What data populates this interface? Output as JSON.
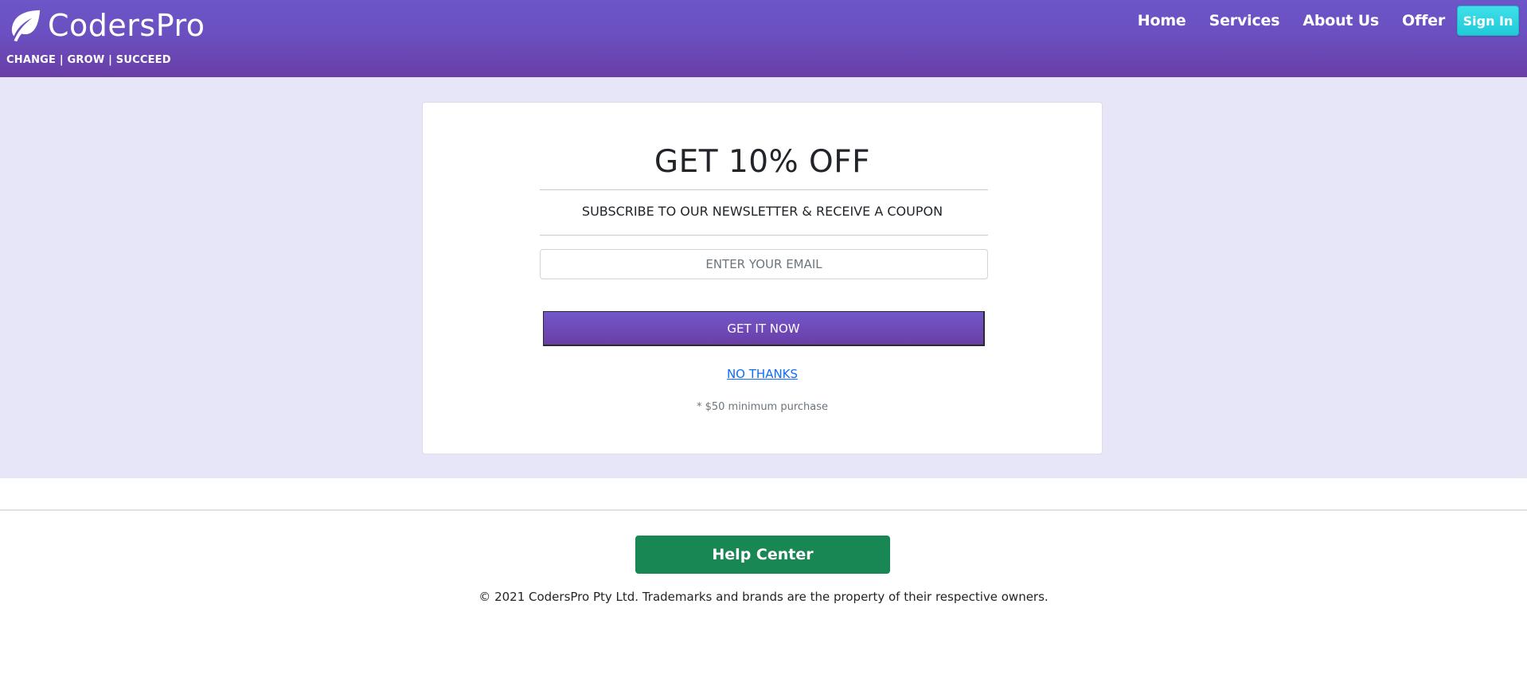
{
  "header": {
    "brand_name": "CodersPro",
    "tagline": "CHANGE | GROW | SUCCEED",
    "brand_icon": "leaf-icon",
    "nav": [
      {
        "label": "Home"
      },
      {
        "label": "Services"
      },
      {
        "label": "About Us"
      },
      {
        "label": "Offer"
      }
    ],
    "signin_label": "Sign In",
    "colors": {
      "header_gradient_top": "#6c56c8",
      "header_gradient_bottom": "#6a3ea6",
      "signin_button": "#21c9d6"
    }
  },
  "offer": {
    "title": "GET 10% OFF",
    "subtitle": "SUBSCRIBE TO OUR NEWSLETTER & RECEIVE A COUPON",
    "email_placeholder": "ENTER YOUR EMAIL",
    "submit_label": "GET IT NOW",
    "decline_label": "NO THANKS",
    "fineprint": "* $50 minimum purchase",
    "colors": {
      "band_background": "#e6e6f8",
      "submit_button": "#6a3ea6",
      "decline_link": "#0d6efd"
    }
  },
  "footer": {
    "help_label": "Help Center",
    "copyright": "© 2021 CodersPro Pty Ltd. Trademarks and brands are the property of their respective owners.",
    "colors": {
      "help_button": "#198754"
    }
  }
}
